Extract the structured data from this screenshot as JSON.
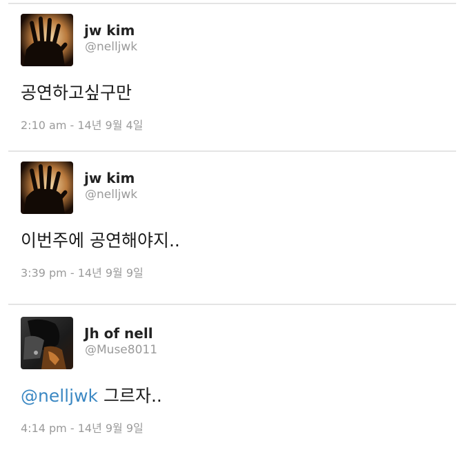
{
  "tweets": [
    {
      "avatar_icon": "raised-hand-photo",
      "name": "jw kim",
      "handle": "@nelljwk",
      "mention": "",
      "text": "공연하고싶구만",
      "time": "2:10 am - 14년 9월 4일"
    },
    {
      "avatar_icon": "raised-hand-photo",
      "name": "jw kim",
      "handle": "@nelljwk",
      "mention": "",
      "text": "이번주에 공연해야지..",
      "time": "3:39 pm - 14년 9월 9일"
    },
    {
      "avatar_icon": "dark-figure-photo",
      "name": "Jh of nell",
      "handle": "@Muse8011",
      "mention": "@nelljwk",
      "text": " 그르자..",
      "time": "4:14 pm - 14년 9월 9일"
    }
  ],
  "colors": {
    "mention": "#3b88c3",
    "meta_gray": "#9a9a9a",
    "divider": "#e4e4e4"
  }
}
